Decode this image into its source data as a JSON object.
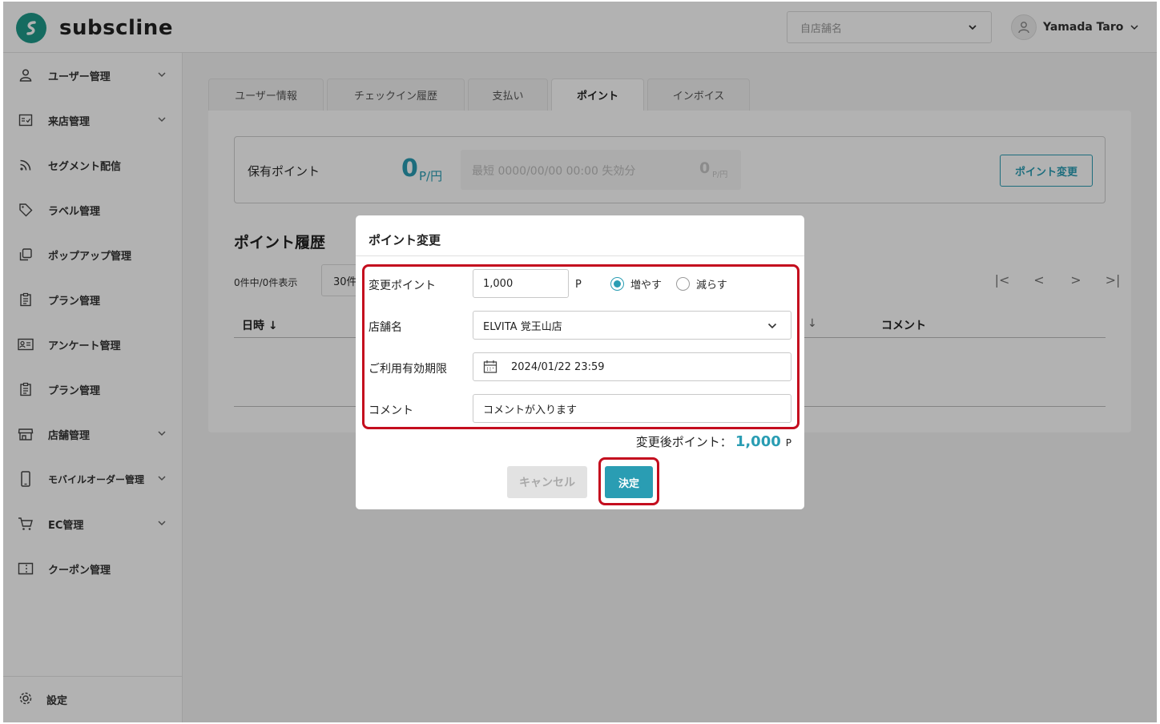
{
  "app": {
    "logo_text": "subscline"
  },
  "header": {
    "store_placeholder": "自店舗名",
    "user_name": "Yamada Taro"
  },
  "sidebar": {
    "items": [
      {
        "label": "ユーザー管理",
        "icon": "user-icon",
        "expandable": true
      },
      {
        "label": "来店管理",
        "icon": "checkin-icon",
        "expandable": true
      },
      {
        "label": "セグメント配信",
        "icon": "rss-icon",
        "expandable": false
      },
      {
        "label": "ラベル管理",
        "icon": "tag-icon",
        "expandable": false
      },
      {
        "label": "ポップアップ管理",
        "icon": "popup-icon",
        "expandable": false
      },
      {
        "label": "プラン管理",
        "icon": "clipboard-icon",
        "expandable": false
      },
      {
        "label": "アンケート管理",
        "icon": "survey-icon",
        "expandable": false
      },
      {
        "label": "プラン管理",
        "icon": "clipboard-icon",
        "expandable": false
      },
      {
        "label": "店舗管理",
        "icon": "store-icon",
        "expandable": true
      },
      {
        "label": "モバイルオーダー管理",
        "icon": "mobile-icon",
        "expandable": true
      },
      {
        "label": "EC管理",
        "icon": "cart-icon",
        "expandable": true
      },
      {
        "label": "クーポン管理",
        "icon": "coupon-icon",
        "expandable": false
      }
    ],
    "settings_label": "設定"
  },
  "tabs": [
    {
      "label": "ユーザー情報",
      "active": false
    },
    {
      "label": "チェックイン履歴",
      "active": false
    },
    {
      "label": "支払い",
      "active": false
    },
    {
      "label": "ポイント",
      "active": true
    },
    {
      "label": "インボイス",
      "active": false
    }
  ],
  "points": {
    "label": "保有ポイント",
    "value": "0",
    "unit": "P/円",
    "expire_text": "最短 0000/00/00 00:00 失効分",
    "expire_value": "0",
    "expire_unit": "P/円",
    "change_button": "ポイント変更"
  },
  "history": {
    "title": "ポイント履歴",
    "count_text": "0件中/0件表示",
    "per_page": "30件",
    "pager": [
      "|<",
      "<",
      ">",
      ">|"
    ],
    "columns": {
      "datetime": "日時 ↓",
      "hidden_sort": "↓",
      "comment": "コメント"
    }
  },
  "modal": {
    "title": "ポイント変更",
    "fields": {
      "points_label": "変更ポイント",
      "points_value": "1,000",
      "points_unit": "P",
      "radio_increase": "増やす",
      "radio_decrease": "減らす",
      "selected": "increase",
      "store_label": "店舗名",
      "store_value": "ELVITA 覚王山店",
      "expiry_label": "ご利用有効期限",
      "expiry_value": "2024/01/22 23:59",
      "comment_label": "コメント",
      "comment_value": "コメントが入ります"
    },
    "after_label": "変更後ポイント：",
    "after_value": "1,000",
    "after_unit": "P",
    "cancel_button": "キャンセル",
    "submit_button": "決定"
  },
  "colors": {
    "accent": "#2a9db3",
    "brand": "#1f9a8a",
    "highlight": "#c40d1e"
  }
}
